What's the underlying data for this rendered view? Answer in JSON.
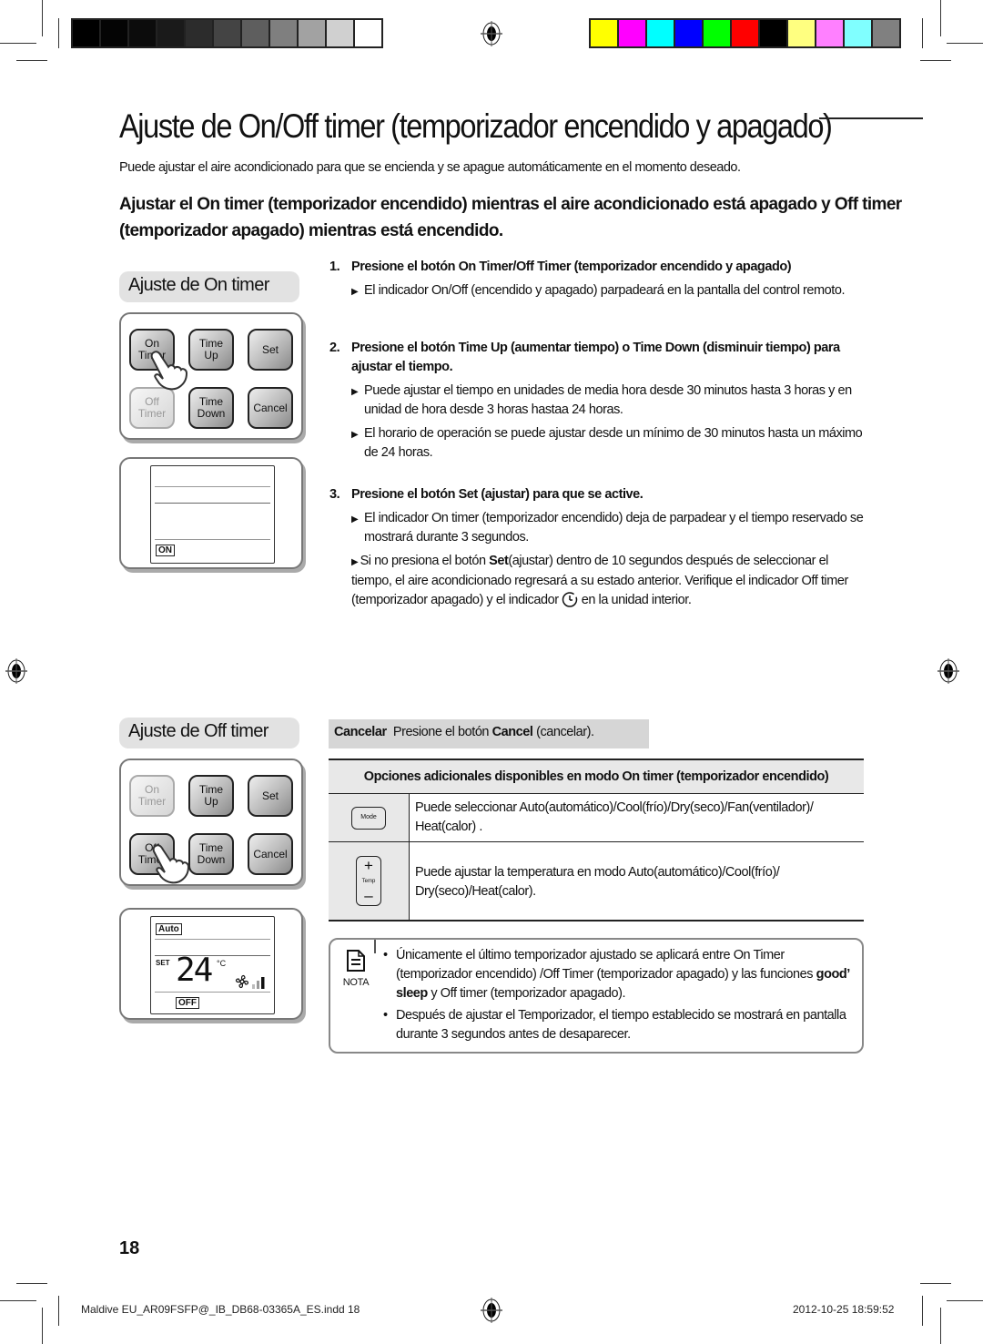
{
  "print_marks": {
    "gray_swatches": [
      "#000000",
      "#040404",
      "#0c0c0c",
      "#1a1a1a",
      "#2c2c2c",
      "#444444",
      "#5e5e5e",
      "#7f7f7f",
      "#a2a2a2",
      "#d0d0d0",
      "#ffffff"
    ],
    "color_swatches": [
      "#ffff00",
      "#ff00ff",
      "#00ffff",
      "#0000ff",
      "#00ff00",
      "#ff0000",
      "#000000",
      "#ffff80",
      "#ff80ff",
      "#80ffff",
      "#808080"
    ]
  },
  "title": "Ajuste de On/Off timer (temporizador encendido y apagado)",
  "intro": "Puede ajustar el aire acondicionado para que se encienda y se apague automáticamente en el momento deseado.",
  "subheading": "Ajustar el On timer (temporizador encendido) mientras el aire acondicionado está apagado y Off timer (temporizador apagado) mientras está encendido.",
  "on_timer_section": {
    "label": "Ajuste de On timer",
    "buttons": {
      "on_timer": [
        "On",
        "Timer"
      ],
      "time_up": [
        "Time",
        "Up"
      ],
      "set": "Set",
      "off_timer": [
        "Off",
        "Timer"
      ],
      "time_down": [
        "Time",
        "Down"
      ],
      "cancel": "Cancel"
    },
    "display_tag": "ON"
  },
  "steps": [
    {
      "num": "1.",
      "text": "Presione el botón On Timer/Off Timer (temporizador encendido y apagado)",
      "bullets": [
        "El indicador On/Off (encendido y apagado) parpadeará en la pantalla del control remoto."
      ]
    },
    {
      "num": "2.",
      "text": "Presione el botón Time Up (aumentar tiempo) o Time Down (disminuir tiempo) para ajustar el tiempo.",
      "bullets": [
        "Puede ajustar el tiempo en unidades de media hora desde 30 minutos hasta 3 horas y en unidad de hora desde 3 horas hastaa 24 horas.",
        "El horario de operación se puede ajustar desde un mínimo de 30 minutos hasta un máximo de 24 horas."
      ]
    },
    {
      "num": "3.",
      "text": "Presione el botón Set (ajustar) para que se active.",
      "bullets": [
        "El indicador On timer (temporizador encendido) deja de parpadear y el tiempo reservado se mostrará durante 3 segundos."
      ],
      "extra": {
        "pre": "Si no presiona el botón ",
        "bold": "Set",
        "mid": "(ajustar) dentro de 10 segundos después de seleccionar el tiempo, el aire acondicionado regresará a su estado anterior. Verifique el indicador Off timer (temporizador apagado) y el indicador ",
        "post": " en la unidad interior."
      }
    }
  ],
  "off_timer_section": {
    "label": "Ajuste de Off timer",
    "buttons": {
      "on_timer": [
        "On",
        "Timer"
      ],
      "time_up": [
        "Time",
        "Up"
      ],
      "set": "Set",
      "off_timer": [
        "Off",
        "Timer"
      ],
      "time_down": [
        "Time",
        "Down"
      ],
      "cancel": "Cancel"
    },
    "display": {
      "mode_tag": "Auto",
      "set_label": "SET",
      "temperature": "24",
      "unit": "°C",
      "fan_level": "2 of 3",
      "timer_tag": "OFF"
    }
  },
  "cancel_bar": {
    "label": "Cancelar",
    "text_pre": "Presione el botón ",
    "bold": "Cancel",
    "text_post": " (cancelar)."
  },
  "options_table": {
    "header": "Opciones adicionales disponibles en modo On timer (temporizador encendido)",
    "rows": [
      {
        "icon": "mode-button",
        "icon_label": "Mode",
        "text": "Puede seleccionar Auto(automático)/Cool(frío)/Dry(seco)/Fan(ventilador)/ Heat(calor) ."
      },
      {
        "icon": "temp-button",
        "icon_label": "Temp",
        "plus": "+",
        "minus": "–",
        "text": "Puede ajustar la temperatura en modo Auto(automático)/Cool(frío)/ Dry(seco)/Heat(calor)."
      }
    ]
  },
  "note": {
    "label": "NOTA",
    "items": [
      {
        "pre": "Únicamente el último temporizador ajustado se aplicará entre On Timer (temporizador encendido) /Off Timer (temporizador apagado) y las funciones ",
        "bold": "good’ sleep",
        "post": " y Off timer (temporizador apagado)."
      },
      {
        "pre": "Después de ajustar el Temporizador, el tiempo establecido se mostrará en pantalla durante 3 segundos antes de desaparecer.",
        "bold": "",
        "post": ""
      }
    ]
  },
  "page_number": "18",
  "slug": {
    "file": "Maldive EU_AR09FSFP@_IB_DB68-03365A_ES.indd   18",
    "timestamp": "2012-10-25   18:59:52"
  }
}
